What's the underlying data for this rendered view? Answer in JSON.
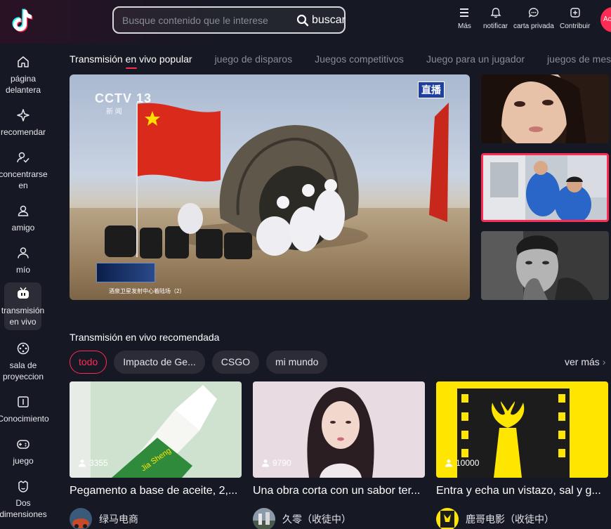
{
  "search": {
    "placeholder": "Busque contenido que le interese",
    "button": "buscar"
  },
  "top_actions": [
    {
      "label": "Más",
      "icon": "menu-icon"
    },
    {
      "label": "notificar",
      "icon": "bell-icon"
    },
    {
      "label": "carta privada",
      "icon": "message-icon"
    },
    {
      "label": "Contribuir",
      "icon": "plus-square-icon"
    }
  ],
  "login_label": "Acceder",
  "sidebar": {
    "items": [
      {
        "label": "página delantera",
        "icon": "home-icon"
      },
      {
        "label": "recomendar",
        "icon": "sparkle-icon"
      },
      {
        "label": "concentrarse en",
        "icon": "follow-icon"
      },
      {
        "label": "amigo",
        "icon": "friends-icon"
      },
      {
        "label": "mío",
        "icon": "user-icon"
      },
      {
        "label": "transmisión en vivo",
        "icon": "live-tv-icon",
        "active": true
      },
      {
        "label": "sala de proyeccion",
        "icon": "film-reel-icon"
      },
      {
        "label": "Conocimiento",
        "icon": "book-icon"
      },
      {
        "label": "juego",
        "icon": "gamepad-icon"
      },
      {
        "label": "Dos dimensiones",
        "icon": "anime-icon"
      }
    ]
  },
  "category_tabs": [
    {
      "label": "Transmisión en vivo popular",
      "active": true
    },
    {
      "label": "juego de disparos"
    },
    {
      "label": "Juegos competitivos"
    },
    {
      "label": "Juego para un jugador"
    },
    {
      "label": "juegos de mesa"
    }
  ],
  "hero": {
    "badge": "直播",
    "channel": "CCTV 13",
    "channel_sub": "新 闻",
    "caption": "酒泉卫星发射中心着陆场（2）"
  },
  "recommended": {
    "title": "Transmisión en vivo recomendada",
    "chips": [
      {
        "label": "todo",
        "active": true
      },
      {
        "label": "Impacto de Ge..."
      },
      {
        "label": "CSGO"
      },
      {
        "label": "mi mundo"
      }
    ],
    "see_more": "ver más",
    "cards": [
      {
        "viewers": "3355",
        "title": "Pegamento a base de aceite, 2,...",
        "author": "绿马电商"
      },
      {
        "viewers": "9790",
        "title": "Una obra corta con un sabor ter...",
        "author": "久零（收徒中）"
      },
      {
        "viewers": "10000",
        "title": "Entra y echa un vistazo, sal y g...",
        "author": "鹿哥电影（收徒中）"
      }
    ]
  }
}
